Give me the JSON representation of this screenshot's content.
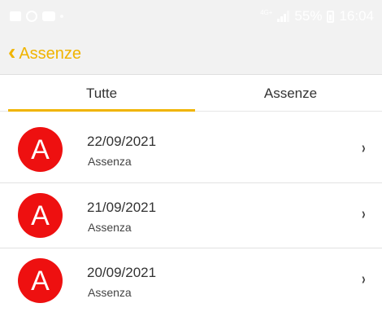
{
  "status_bar": {
    "network_label": "4G+",
    "battery_text": "55%",
    "time": "16:04",
    "icons": [
      "gallery-icon",
      "whatsapp-icon",
      "video-icon",
      "signal-icon",
      "battery-icon"
    ]
  },
  "app_bar": {
    "back_icon": "‹",
    "title": "Assenze",
    "accent_color": "#f0b400"
  },
  "tabs": [
    {
      "label": "Tutte",
      "selected": true
    },
    {
      "label": "Assenze",
      "selected": false
    }
  ],
  "items": [
    {
      "avatar_letter": "A",
      "date": "22/09/2021",
      "type": "Assenza"
    },
    {
      "avatar_letter": "A",
      "date": "21/09/2021",
      "type": "Assenza"
    },
    {
      "avatar_letter": "A",
      "date": "20/09/2021",
      "type": "Assenza"
    }
  ],
  "chevron": "›",
  "avatar_color": "#ee1010"
}
